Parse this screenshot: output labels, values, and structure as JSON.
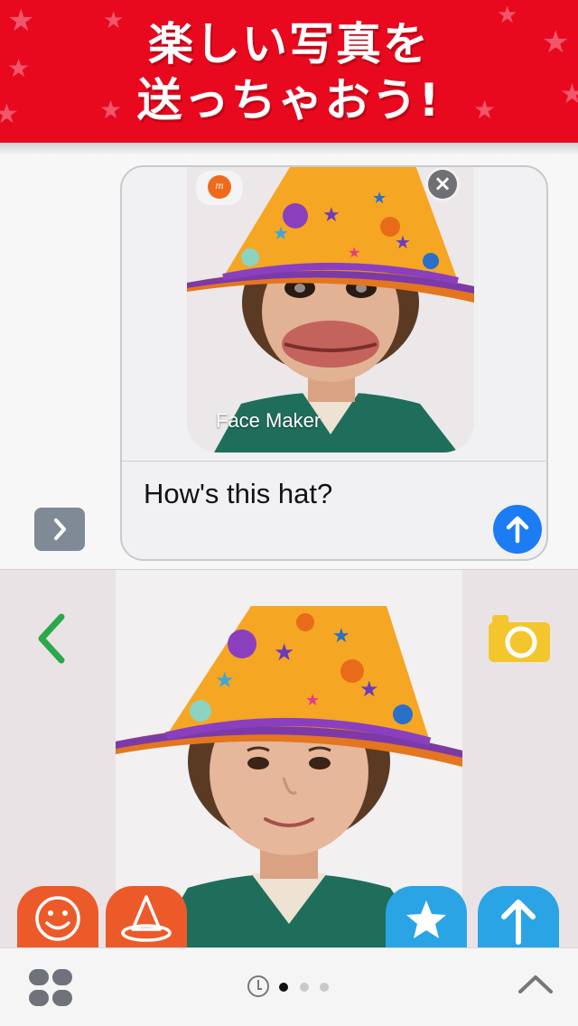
{
  "banner": {
    "line1": "楽しい写真を",
    "line2": "送っちゃおう!"
  },
  "compose": {
    "app_badge_text": "m",
    "sticker_caption": "Face Maker",
    "message_text": "How's this hat?",
    "close_icon": "close-icon",
    "send_icon": "arrow-up-icon"
  },
  "drawer": {
    "back_icon": "chevron-left-icon",
    "camera_icon": "camera-icon",
    "tools": [
      "face-icon",
      "witch-hat-icon",
      "star-icon",
      "upload-icon"
    ]
  },
  "bottom_bar": {
    "apps_icon": "app-grid-icon",
    "recent_icon": "clock-icon",
    "collapse_icon": "chevron-up-icon",
    "pages": 3,
    "current_page": 1
  },
  "colors": {
    "banner_red": "#e8091f",
    "send_blue": "#1b7cf4",
    "tool_orange": "#ec5a2a",
    "tool_blue": "#2ba4e6",
    "back_green": "#2aa84a",
    "camera_yellow": "#f3c62d",
    "hat_orange": "#f5a623"
  }
}
